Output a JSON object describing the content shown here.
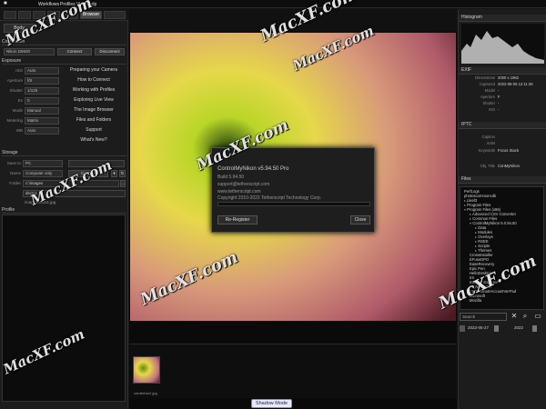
{
  "menubar": {
    "items": [
      "Workflows",
      "Profiles",
      "View",
      "Help"
    ]
  },
  "left": {
    "tabs": [
      "Body",
      "Browser"
    ],
    "sections": {
      "connection": "Connection",
      "exposure": "Exposure",
      "storage": "Storage",
      "profiles": "Profile",
      "default": "Default"
    },
    "camera_select": "Nikon D5600",
    "connect_label": "Connect",
    "disconnect_label": "Disconnect",
    "exposure_rows": [
      "ISO",
      "Aperture",
      "Shutter",
      "Ev",
      "Mode",
      "Metering",
      "WB"
    ],
    "exposure_values": [
      "Auto",
      "f/8",
      "1/125",
      "0",
      "Manual",
      "Matrix",
      "Auto"
    ],
    "links": [
      "Preparing your Camera",
      "How to Connect",
      "Working with Profiles",
      "Exploring Live View",
      "The Image Browser",
      "Files and Folders",
      "Support",
      "What's New?"
    ],
    "storage": {
      "save_label": "Save to",
      "save_value": "PC",
      "name_label": "Name",
      "name_value": "Computer only",
      "counter_label": "Counter",
      "folder_label": "Folder",
      "folder_value": "c:\\images",
      "prefix_value": "dscC1",
      "filename_value": "images00001.jpg"
    }
  },
  "dialog": {
    "title": "ControlMyNikon v5.94.50 Pro",
    "build": "Build 5.94.50",
    "email": "support@tetherscript.com",
    "website": "www.tetherscript.com",
    "copyright": "Copyright 2010-2022 Tetherscript Technology Corp.",
    "register_label": "Re-Register",
    "close_label": "Close"
  },
  "filmstrip": {
    "thumb_caption": "centerbar2.jpg",
    "shadow_mode_label": "Shadow Mode"
  },
  "right": {
    "histogram_title": "Histogram",
    "exif_title": "EXIF",
    "exif": [
      {
        "k": "Dimensions",
        "v": "2000 x 1982"
      },
      {
        "k": "Captured",
        "v": "2022-08-05 12:11:36"
      },
      {
        "k": "Model",
        "v": "-"
      },
      {
        "k": "Aperture",
        "v": "F"
      },
      {
        "k": "Shutter",
        "v": "-"
      },
      {
        "k": "ISO",
        "v": "-"
      }
    ],
    "iptc_title": "IPTC",
    "iptc": [
      {
        "k": "Caption",
        "v": ""
      },
      {
        "k": "Artist",
        "v": ""
      },
      {
        "k": "Keywords",
        "v": "Focus Stack"
      },
      {
        "k": "Obj. Title",
        "v": "ConMyNikon"
      }
    ],
    "files_title": "Files",
    "files": [
      {
        "label": "PerfLogs",
        "indent": 0,
        "tri": ""
      },
      {
        "label": "photoscommoncdk",
        "indent": 0,
        "tri": ""
      },
      {
        "label": "pixel3",
        "indent": 0,
        "tri": "▸"
      },
      {
        "label": "Program Files",
        "indent": 0,
        "tri": "▸"
      },
      {
        "label": "Program Files (x86)",
        "indent": 0,
        "tri": "▾"
      },
      {
        "label": "Advanced CSV Converter",
        "indent": 1,
        "tri": "▸"
      },
      {
        "label": "Common Files",
        "indent": 1,
        "tri": "▸"
      },
      {
        "label": "ControlMyNikon 5.0.94.50",
        "indent": 1,
        "tri": "▾"
      },
      {
        "label": "Data",
        "indent": 2,
        "tri": "▸"
      },
      {
        "label": "Modules",
        "indent": 2,
        "tri": "▸"
      },
      {
        "label": "Overlays",
        "indent": 2,
        "tri": "▸"
      },
      {
        "label": "RSEE",
        "indent": 2,
        "tri": "▸"
      },
      {
        "label": "Scripts",
        "indent": 2,
        "tri": "▸"
      },
      {
        "label": "Themes",
        "indent": 2,
        "tri": "▸"
      },
      {
        "label": "CrossInstaller",
        "indent": 1,
        "tri": ""
      },
      {
        "label": "EFuseDPO",
        "indent": 1,
        "tri": ""
      },
      {
        "label": "EaseRecovery",
        "indent": 1,
        "tri": ""
      },
      {
        "label": "Epic Pen",
        "indent": 1,
        "tri": ""
      },
      {
        "label": "HelloDesktop",
        "indent": 1,
        "tri": ""
      },
      {
        "label": "IIS",
        "indent": 1,
        "tri": ""
      },
      {
        "label": "Internet Explorer",
        "indent": 1,
        "tri": ""
      },
      {
        "label": "KeyWrangler",
        "indent": 1,
        "tri": ""
      },
      {
        "label": "Kat3ZSmartAccountVerPad",
        "indent": 1,
        "tri": ""
      },
      {
        "label": "Microsoft",
        "indent": 1,
        "tri": ""
      },
      {
        "label": "Mozilla",
        "indent": 1,
        "tri": ""
      }
    ],
    "search_value": "Search",
    "date_value": "2022-05-27",
    "date_value2": "2022"
  },
  "watermark": "MacXF.com"
}
